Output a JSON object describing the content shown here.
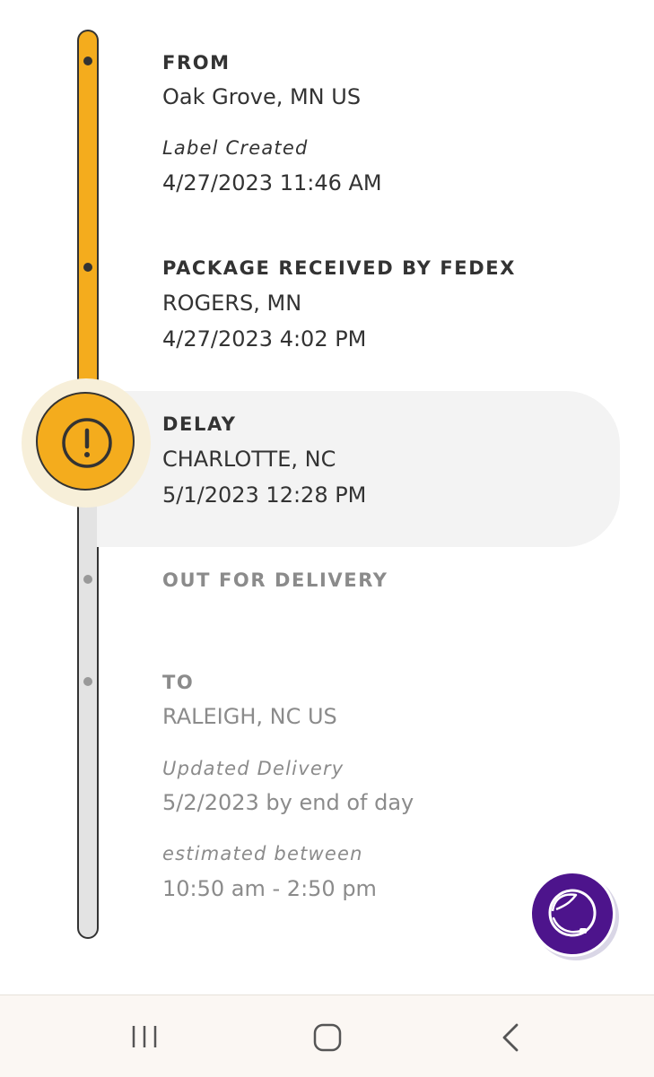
{
  "events": [
    {
      "title": "FROM",
      "location": "Oak Grove, MN US",
      "status": "Label Created",
      "datetime": "4/27/2023 11:46 AM"
    },
    {
      "title": "PACKAGE RECEIVED BY FEDEX",
      "location": "ROGERS, MN",
      "datetime": "4/27/2023 4:02 PM"
    },
    {
      "title": "DELAY",
      "location": "CHARLOTTE, NC",
      "datetime": "5/1/2023 12:28 PM"
    },
    {
      "title": "OUT FOR DELIVERY"
    },
    {
      "title": "TO",
      "location": "RALEIGH, NC US",
      "status": "Updated Delivery",
      "datetime": "5/2/2023 by end of day",
      "window_label": "estimated between",
      "window": "10:50 am - 2:50 pm"
    }
  ],
  "icons": {
    "delay": "exclamation-circle-icon",
    "chat": "virtual-assistant-icon",
    "nav_recents": "recents-icon",
    "nav_home": "home-icon",
    "nav_back": "back-icon"
  },
  "colors": {
    "progress": "#f4ac1d",
    "pending": "#e3e3e3",
    "brand_purple": "#4d148c",
    "muted_text": "#8b8b8b"
  }
}
